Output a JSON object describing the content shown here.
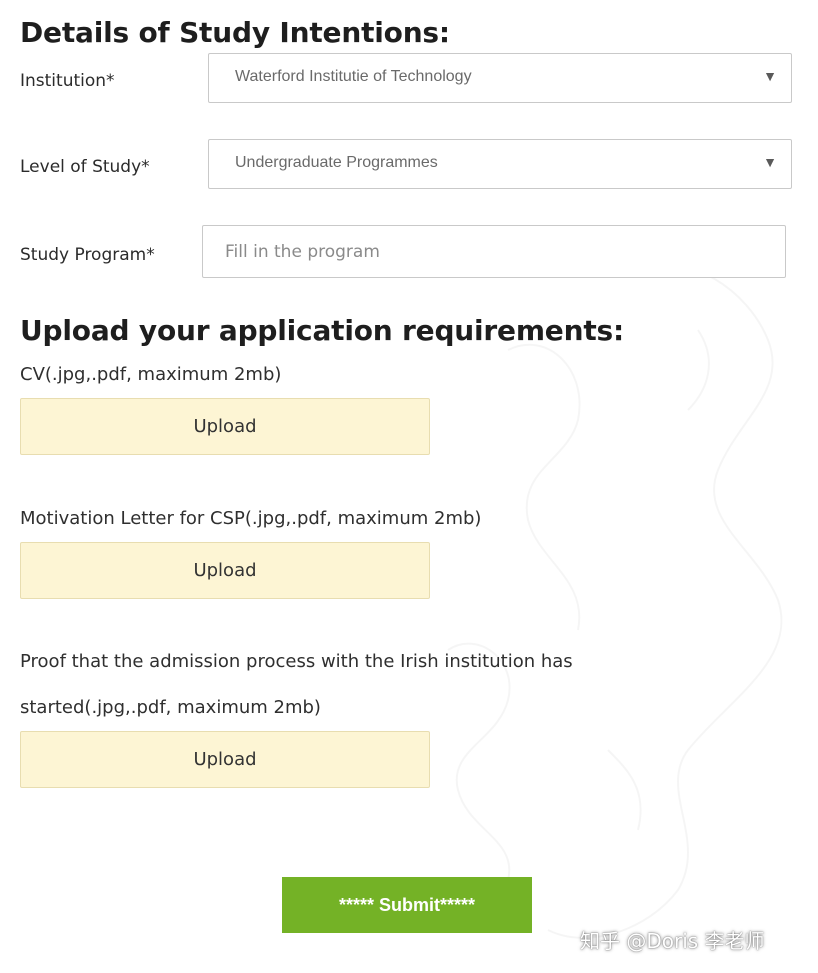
{
  "study_intentions": {
    "title": "Details of Study Intentions:",
    "institution": {
      "label": "Institution*",
      "value": "Waterford Institutie of Technology"
    },
    "level": {
      "label": "Level of Study*",
      "value": "Undergraduate Programmes"
    },
    "program": {
      "label": "Study Program*",
      "placeholder": "Fill in the program",
      "value": ""
    }
  },
  "uploads": {
    "title": "Upload your application requirements:",
    "cv": {
      "label": "CV(.jpg,.pdf, maximum 2mb)",
      "button": "Upload"
    },
    "motivation": {
      "label": "Motivation Letter for CSP(.jpg,.pdf, maximum 2mb)",
      "button": "Upload"
    },
    "proof": {
      "label_line1": "Proof that the admission process with the Irish institution has",
      "label_line2": "started(.jpg,.pdf, maximum 2mb)",
      "button": "Upload"
    }
  },
  "submit": {
    "label": "***** Submit*****"
  },
  "watermark": "知乎 @Doris 李老师",
  "icons": {
    "dropdown_arrow": "▼"
  },
  "colors": {
    "upload_bg": "#fdf5d4",
    "submit_bg": "#74b226"
  }
}
